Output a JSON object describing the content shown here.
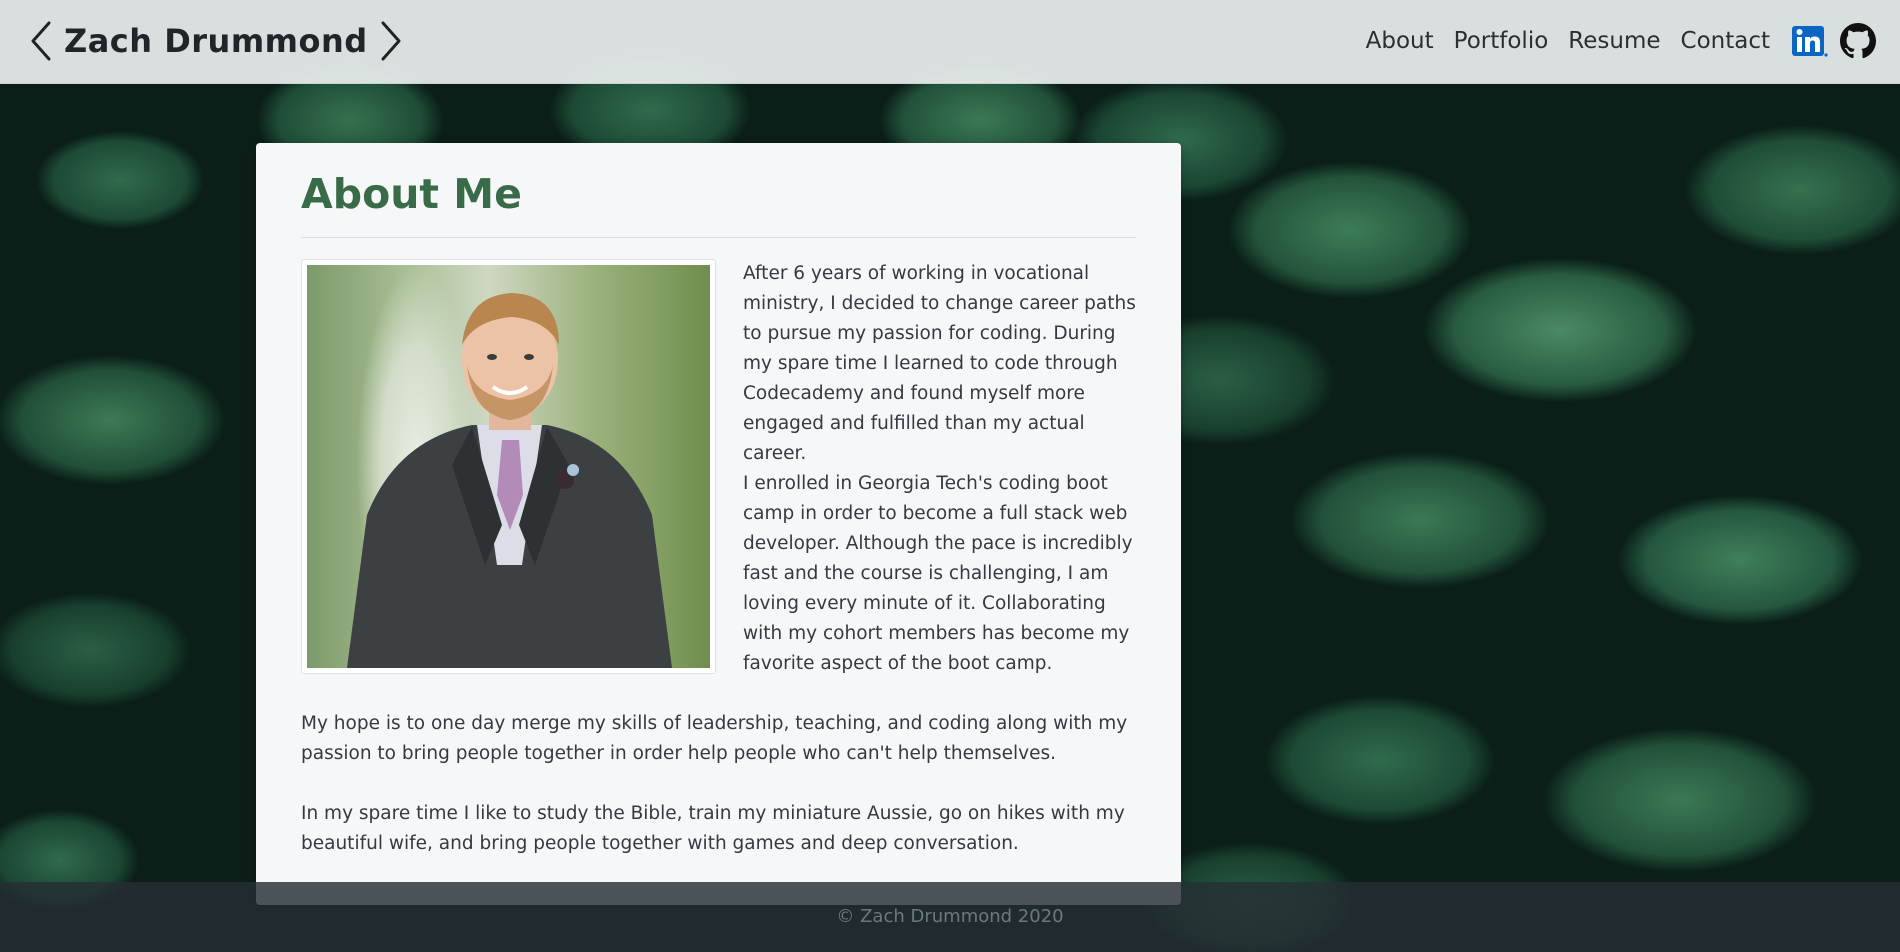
{
  "header": {
    "brand": "Zach Drummond",
    "nav": [
      "About",
      "Portfolio",
      "Resume",
      "Contact"
    ]
  },
  "about": {
    "title": "About Me",
    "paragraphs": [
      "After 6 years of working in vocational ministry, I decided to change career paths to pursue my passion for coding. During my spare time I learned to code through Codecademy and found myself more engaged and fulfilled than my actual career.",
      "I enrolled in Georgia Tech's coding boot camp in order to become a full stack web developer. Although the pace is incredibly fast and the course is challenging, I am loving every minute of it. Collaborating with my cohort members has become my favorite aspect of the boot camp.",
      "My hope is to one day merge my skills of leadership, teaching, and coding along with my passion to bring people together in order help people who can't help themselves.",
      "In my spare time I like to study the Bible, train my miniature Aussie, go on hikes with my beautiful wife, and bring people together with games and deep conversation."
    ]
  },
  "footer": {
    "text": "© Zach Drummond 2020"
  },
  "icons": {
    "brand_left": "chevron-left-icon",
    "brand_right": "chevron-right-icon",
    "linkedin": "linkedin-icon",
    "github": "github-icon"
  },
  "colors": {
    "title": "#3a6b49",
    "linkedin": "#0a66c2"
  }
}
